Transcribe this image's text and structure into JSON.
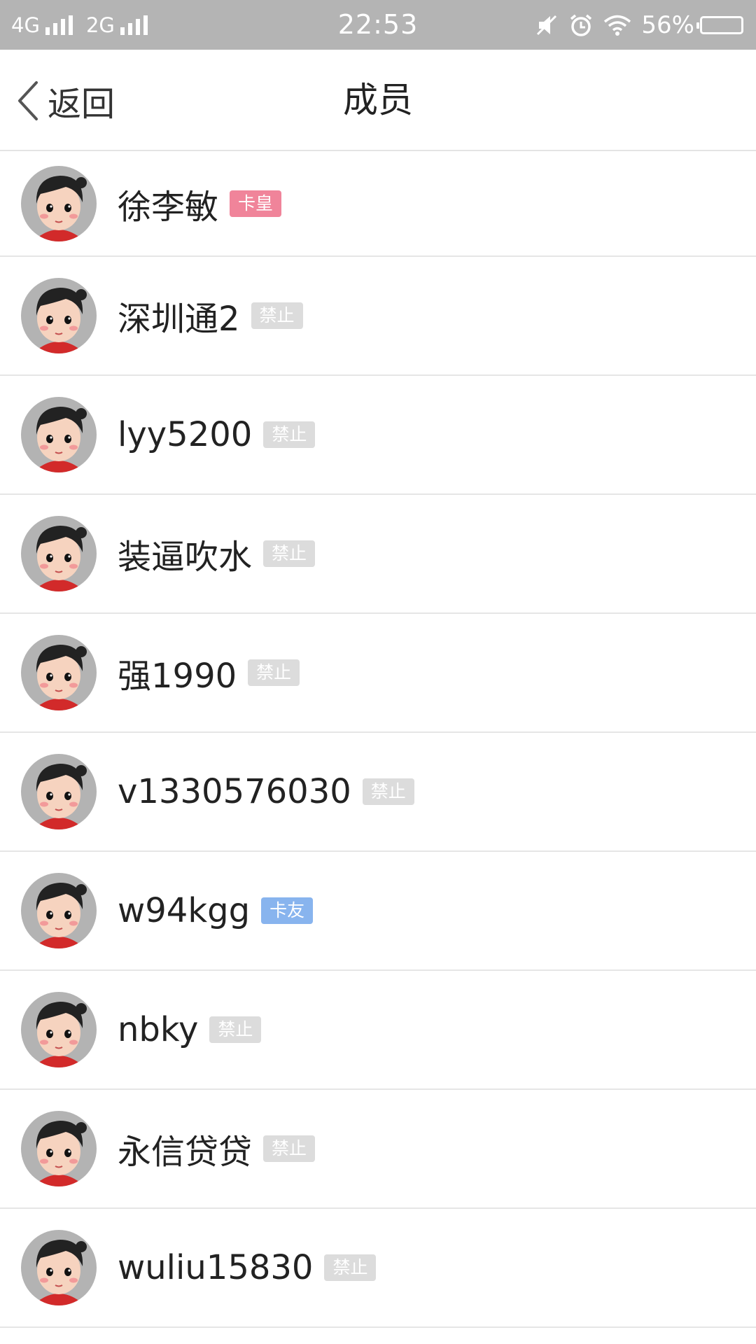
{
  "status_bar": {
    "net1": "4G",
    "net2": "2G",
    "time": "22:53",
    "battery": "56%",
    "icons": [
      "signal-icon",
      "mute-icon",
      "alarm-icon",
      "wifi-icon",
      "battery-icon"
    ]
  },
  "nav": {
    "back_label": "返回",
    "title": "成员"
  },
  "badge_colors": {
    "卡皇": "#f0849a",
    "卡友": "#88b4ee",
    "禁止": "#dcdcdc"
  },
  "members": [
    {
      "name": "徐李敏",
      "badge": "卡皇"
    },
    {
      "name": "深圳通2",
      "badge": "禁止"
    },
    {
      "name": "lyy5200",
      "badge": "禁止"
    },
    {
      "name": "装逼吹水",
      "badge": "禁止"
    },
    {
      "name": "强1990",
      "badge": "禁止"
    },
    {
      "name": "v1330576030",
      "badge": "禁止"
    },
    {
      "name": "w94kgg",
      "badge": "卡友"
    },
    {
      "name": "nbky",
      "badge": "禁止"
    },
    {
      "name": "永信贷贷",
      "badge": "禁止"
    },
    {
      "name": "wuliu15830",
      "badge": "禁止"
    }
  ]
}
